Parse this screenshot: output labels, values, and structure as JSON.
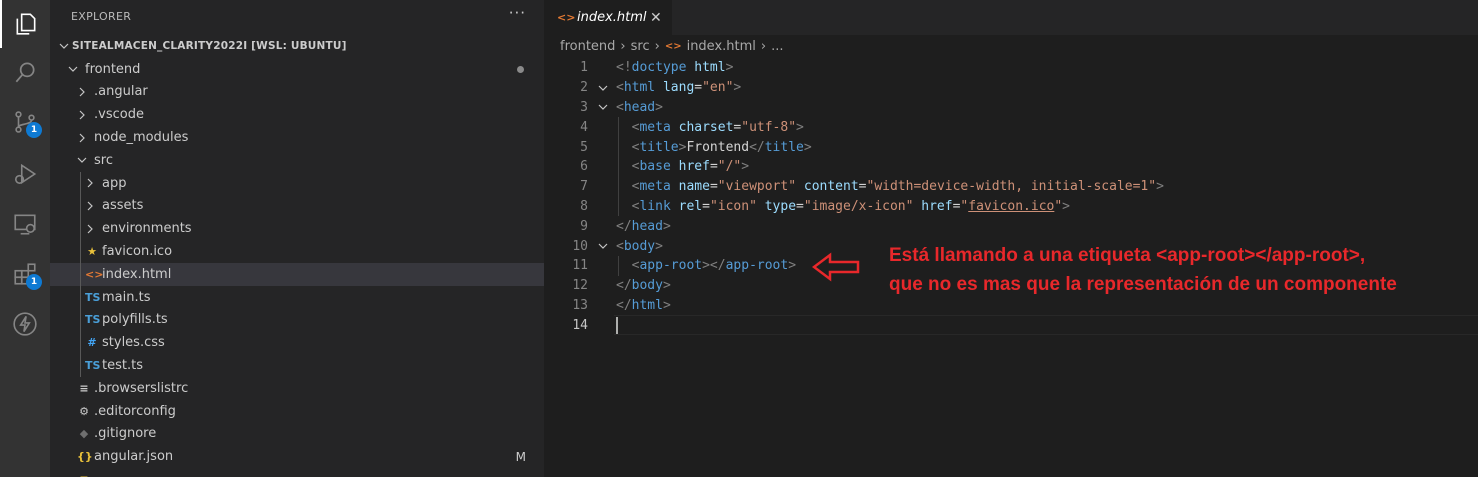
{
  "activity_bar": {
    "items": [
      {
        "name": "explorer-icon"
      },
      {
        "name": "search-icon"
      },
      {
        "name": "source-control-icon",
        "badge": "1"
      },
      {
        "name": "run-debug-icon"
      },
      {
        "name": "remote-explorer-icon"
      },
      {
        "name": "extensions-icon",
        "badge": "1"
      },
      {
        "name": "lightning-icon"
      }
    ]
  },
  "sidebar": {
    "title": "EXPLORER",
    "more": "···",
    "tree": [
      {
        "label": "SITEALMACEN_CLARITY2022I [WSL: UBUNTU]",
        "depth": 0,
        "kind": "project",
        "expanded": true
      },
      {
        "label": "frontend",
        "depth": 1,
        "kind": "folder",
        "expanded": true,
        "modified_dot": true
      },
      {
        "label": ".angular",
        "depth": 2,
        "kind": "folder",
        "expanded": false
      },
      {
        "label": ".vscode",
        "depth": 2,
        "kind": "folder",
        "expanded": false
      },
      {
        "label": "node_modules",
        "depth": 2,
        "kind": "folder",
        "expanded": false
      },
      {
        "label": "src",
        "depth": 2,
        "kind": "folder",
        "expanded": true
      },
      {
        "label": "app",
        "depth": 3,
        "kind": "folder",
        "expanded": false
      },
      {
        "label": "assets",
        "depth": 3,
        "kind": "folder",
        "expanded": false
      },
      {
        "label": "environments",
        "depth": 3,
        "kind": "folder",
        "expanded": false
      },
      {
        "label": "favicon.ico",
        "depth": 3,
        "kind": "file",
        "icon": "★",
        "icon_color": "#e9c13a"
      },
      {
        "label": "index.html",
        "depth": 3,
        "kind": "file",
        "icon": "<>",
        "icon_color": "#e37933",
        "selected": true
      },
      {
        "label": "main.ts",
        "depth": 3,
        "kind": "file",
        "icon": "TS",
        "icon_color": "#4a9fd8"
      },
      {
        "label": "polyfills.ts",
        "depth": 3,
        "kind": "file",
        "icon": "TS",
        "icon_color": "#4a9fd8"
      },
      {
        "label": "styles.css",
        "depth": 3,
        "kind": "file",
        "icon": "#",
        "icon_color": "#42a5f5"
      },
      {
        "label": "test.ts",
        "depth": 3,
        "kind": "file",
        "icon": "TS",
        "icon_color": "#4a9fd8"
      },
      {
        "label": ".browserslistrc",
        "depth": 2,
        "kind": "file",
        "icon": "≡",
        "icon_color": "#cccccc"
      },
      {
        "label": ".editorconfig",
        "depth": 2,
        "kind": "file",
        "icon": "⚙",
        "icon_color": "#cccccc"
      },
      {
        "label": ".gitignore",
        "depth": 2,
        "kind": "file",
        "icon": "◆",
        "icon_color": "#6f6f6f"
      },
      {
        "label": "angular.json",
        "depth": 2,
        "kind": "file",
        "icon": "{}",
        "icon_color": "#e9c13a",
        "status": "M"
      },
      {
        "label": "",
        "depth": 2,
        "kind": "file",
        "icon": "≡",
        "icon_color": "#e9c13a"
      }
    ]
  },
  "tab": {
    "icon": "<>",
    "label": "index.html",
    "close": "✕"
  },
  "breadcrumb": {
    "parts": [
      "frontend",
      "src",
      "index.html",
      "..."
    ]
  },
  "editor": {
    "current_line": 14,
    "lines": [
      {
        "num": "1",
        "fold": false,
        "tokens": [
          [
            "br",
            "<!"
          ],
          [
            "tag",
            "doctype"
          ],
          [
            "txt",
            " "
          ],
          [
            "attr",
            "html"
          ],
          [
            "br",
            ">"
          ]
        ]
      },
      {
        "num": "2",
        "fold": true,
        "tokens": [
          [
            "br",
            "<"
          ],
          [
            "tag",
            "html"
          ],
          [
            "txt",
            " "
          ],
          [
            "attr",
            "lang"
          ],
          [
            "txt",
            "="
          ],
          [
            "str",
            "\"en\""
          ],
          [
            "br",
            ">"
          ]
        ]
      },
      {
        "num": "3",
        "fold": true,
        "tokens": [
          [
            "br",
            "<"
          ],
          [
            "tag",
            "head"
          ],
          [
            "br",
            ">"
          ]
        ]
      },
      {
        "num": "4",
        "fold": false,
        "tokens": [
          [
            "txt",
            "  "
          ],
          [
            "br",
            "<"
          ],
          [
            "tag",
            "meta"
          ],
          [
            "txt",
            " "
          ],
          [
            "attr",
            "charset"
          ],
          [
            "txt",
            "="
          ],
          [
            "str",
            "\"utf-8\""
          ],
          [
            "br",
            ">"
          ]
        ]
      },
      {
        "num": "5",
        "fold": false,
        "tokens": [
          [
            "txt",
            "  "
          ],
          [
            "br",
            "<"
          ],
          [
            "tag",
            "title"
          ],
          [
            "br",
            ">"
          ],
          [
            "txt",
            "Frontend"
          ],
          [
            "br",
            "</"
          ],
          [
            "tag",
            "title"
          ],
          [
            "br",
            ">"
          ]
        ]
      },
      {
        "num": "6",
        "fold": false,
        "tokens": [
          [
            "txt",
            "  "
          ],
          [
            "br",
            "<"
          ],
          [
            "tag",
            "base"
          ],
          [
            "txt",
            " "
          ],
          [
            "attr",
            "href"
          ],
          [
            "txt",
            "="
          ],
          [
            "str",
            "\"/\""
          ],
          [
            "br",
            ">"
          ]
        ]
      },
      {
        "num": "7",
        "fold": false,
        "tokens": [
          [
            "txt",
            "  "
          ],
          [
            "br",
            "<"
          ],
          [
            "tag",
            "meta"
          ],
          [
            "txt",
            " "
          ],
          [
            "attr",
            "name"
          ],
          [
            "txt",
            "="
          ],
          [
            "str",
            "\"viewport\""
          ],
          [
            "txt",
            " "
          ],
          [
            "attr",
            "content"
          ],
          [
            "txt",
            "="
          ],
          [
            "str",
            "\"width=device-width, initial-scale=1\""
          ],
          [
            "br",
            ">"
          ]
        ]
      },
      {
        "num": "8",
        "fold": false,
        "tokens": [
          [
            "txt",
            "  "
          ],
          [
            "br",
            "<"
          ],
          [
            "tag",
            "link"
          ],
          [
            "txt",
            " "
          ],
          [
            "attr",
            "rel"
          ],
          [
            "txt",
            "="
          ],
          [
            "str",
            "\"icon\""
          ],
          [
            "txt",
            " "
          ],
          [
            "attr",
            "type"
          ],
          [
            "txt",
            "="
          ],
          [
            "str",
            "\"image/x-icon\""
          ],
          [
            "txt",
            " "
          ],
          [
            "attr",
            "href"
          ],
          [
            "txt",
            "="
          ],
          [
            "str",
            "\""
          ],
          [
            "link",
            "favicon.ico"
          ],
          [
            "str",
            "\""
          ],
          [
            "br",
            ">"
          ]
        ]
      },
      {
        "num": "9",
        "fold": false,
        "tokens": [
          [
            "br",
            "</"
          ],
          [
            "tag",
            "head"
          ],
          [
            "br",
            ">"
          ]
        ]
      },
      {
        "num": "10",
        "fold": true,
        "tokens": [
          [
            "br",
            "<"
          ],
          [
            "tag",
            "body"
          ],
          [
            "br",
            ">"
          ]
        ]
      },
      {
        "num": "11",
        "fold": false,
        "tokens": [
          [
            "txt",
            "  "
          ],
          [
            "br",
            "<"
          ],
          [
            "tag",
            "app-root"
          ],
          [
            "br",
            "></"
          ],
          [
            "tag",
            "app-root"
          ],
          [
            "br",
            ">"
          ]
        ]
      },
      {
        "num": "12",
        "fold": false,
        "tokens": [
          [
            "br",
            "</"
          ],
          [
            "tag",
            "body"
          ],
          [
            "br",
            ">"
          ]
        ]
      },
      {
        "num": "13",
        "fold": false,
        "tokens": [
          [
            "br",
            "</"
          ],
          [
            "tag",
            "html"
          ],
          [
            "br",
            ">"
          ]
        ]
      },
      {
        "num": "14",
        "fold": false,
        "tokens": []
      }
    ]
  },
  "annotation": {
    "lines": [
      "Está llamando a una etiqueta <app-root></app-root>,",
      "que no es mas que la representación de un componente"
    ],
    "color": "#e8282b"
  }
}
